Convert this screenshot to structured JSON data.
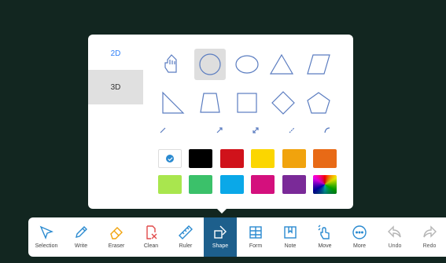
{
  "shape_panel": {
    "tabs": [
      {
        "label": "2D",
        "active": true
      },
      {
        "label": "3D",
        "active": false
      }
    ],
    "shapes_row1": [
      "pointing-hand-icon",
      "circle-shape-icon",
      "ellipse-shape-icon",
      "triangle-shape-icon",
      "parallelogram-shape-icon"
    ],
    "shapes_row2": [
      "right-triangle-shape-icon",
      "trapezoid-shape-icon",
      "square-shape-icon",
      "diamond-shape-icon",
      "pentagon-shape-icon"
    ],
    "line_styles": [
      "line-icon",
      "arrow-line-icon",
      "double-arrow-line-icon",
      "dashed-line-icon",
      "arc-line-icon"
    ],
    "selected_shape": "circle",
    "colors": [
      "#ffffff",
      "#000000",
      "#d0121b",
      "#fbd600",
      "#f1a30d",
      "#e86a16",
      "#a9e64e",
      "#3bc16a",
      "#0aa8e8",
      "#d4107d",
      "#7a2a98",
      "spectrum"
    ],
    "selected_color": "#ffffff"
  },
  "toolbar": {
    "selection": "Selection",
    "write": "Write",
    "eraser": "Eraser",
    "clean": "Clean",
    "ruler": "Ruler",
    "shape": "Shape",
    "form": "Form",
    "note": "Note",
    "move": "Move",
    "more": "More",
    "undo": "Undo",
    "redo": "Redo",
    "active": "Shape"
  },
  "colors": {
    "accent": "#1d5f8c",
    "icon_blue": "#2a8ad0",
    "background": "#122620"
  }
}
